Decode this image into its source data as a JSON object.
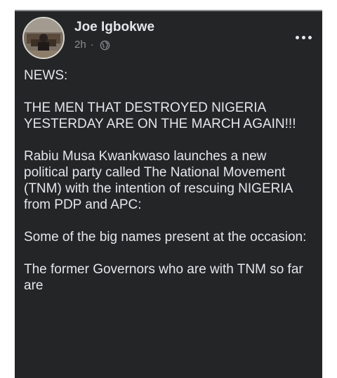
{
  "post": {
    "author": "Joe Igbokwe",
    "time": "2h",
    "separator": "·",
    "privacy_icon": "globe-icon",
    "more_icon": "more-options-icon",
    "paragraphs": [
      "NEWS:",
      "THE MEN THAT DESTROYED NIGERIA YESTERDAY ARE ON THE MARCH AGAIN!!!",
      "Rabiu Musa Kwankwaso launches a new political party called The National Movement (TNM) with the intention of rescuing NIGERIA from PDP and APC:",
      "Some of the big names present at the occasion:",
      "The former Governors who are with TNM so far are"
    ]
  },
  "colors": {
    "card_background": "#242526",
    "primary_text": "#e4e6eb",
    "secondary_text": "#8a8d91"
  }
}
